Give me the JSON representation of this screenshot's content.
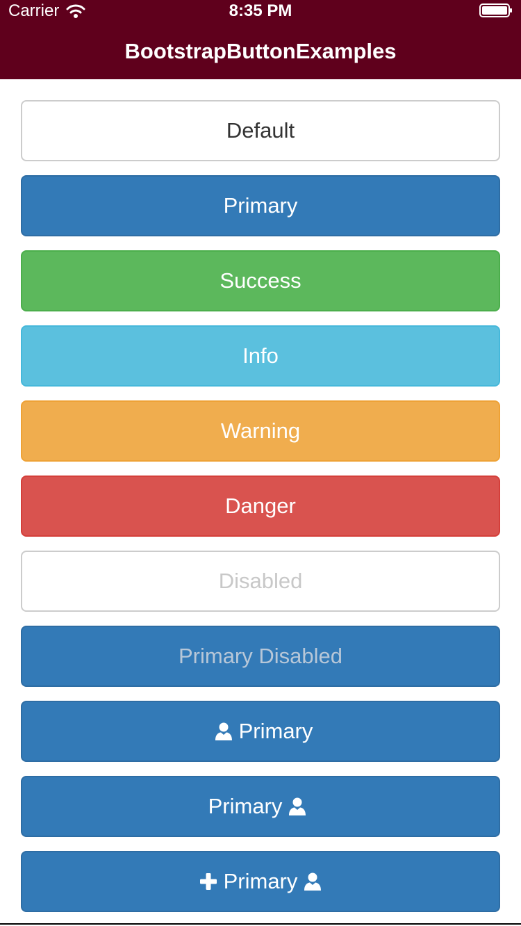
{
  "status_bar": {
    "carrier": "Carrier",
    "time": "8:35 PM",
    "wifi_icon": "wifi-icon",
    "battery_icon": "battery-icon"
  },
  "nav": {
    "title": "BootstrapButtonExamples"
  },
  "colors": {
    "nav_background": "#5f001c",
    "default": "#ffffff",
    "primary": "#337ab7",
    "success": "#5cb85c",
    "info": "#5bc0de",
    "warning": "#f0ad4e",
    "danger": "#d9534f"
  },
  "buttons": {
    "default": {
      "label": "Default"
    },
    "primary": {
      "label": "Primary"
    },
    "success": {
      "label": "Success"
    },
    "info": {
      "label": "Info"
    },
    "warning": {
      "label": "Warning"
    },
    "danger": {
      "label": "Danger"
    },
    "disabled": {
      "label": "Disabled"
    },
    "primary_disabled": {
      "label": "Primary Disabled"
    },
    "primary_icon_left": {
      "label": "Primary",
      "icon_left": "user-icon"
    },
    "primary_icon_right": {
      "label": "Primary",
      "icon_right": "user-icon"
    },
    "primary_icon_both": {
      "label": "Primary",
      "icon_left": "plus-icon",
      "icon_right": "user-icon"
    }
  }
}
